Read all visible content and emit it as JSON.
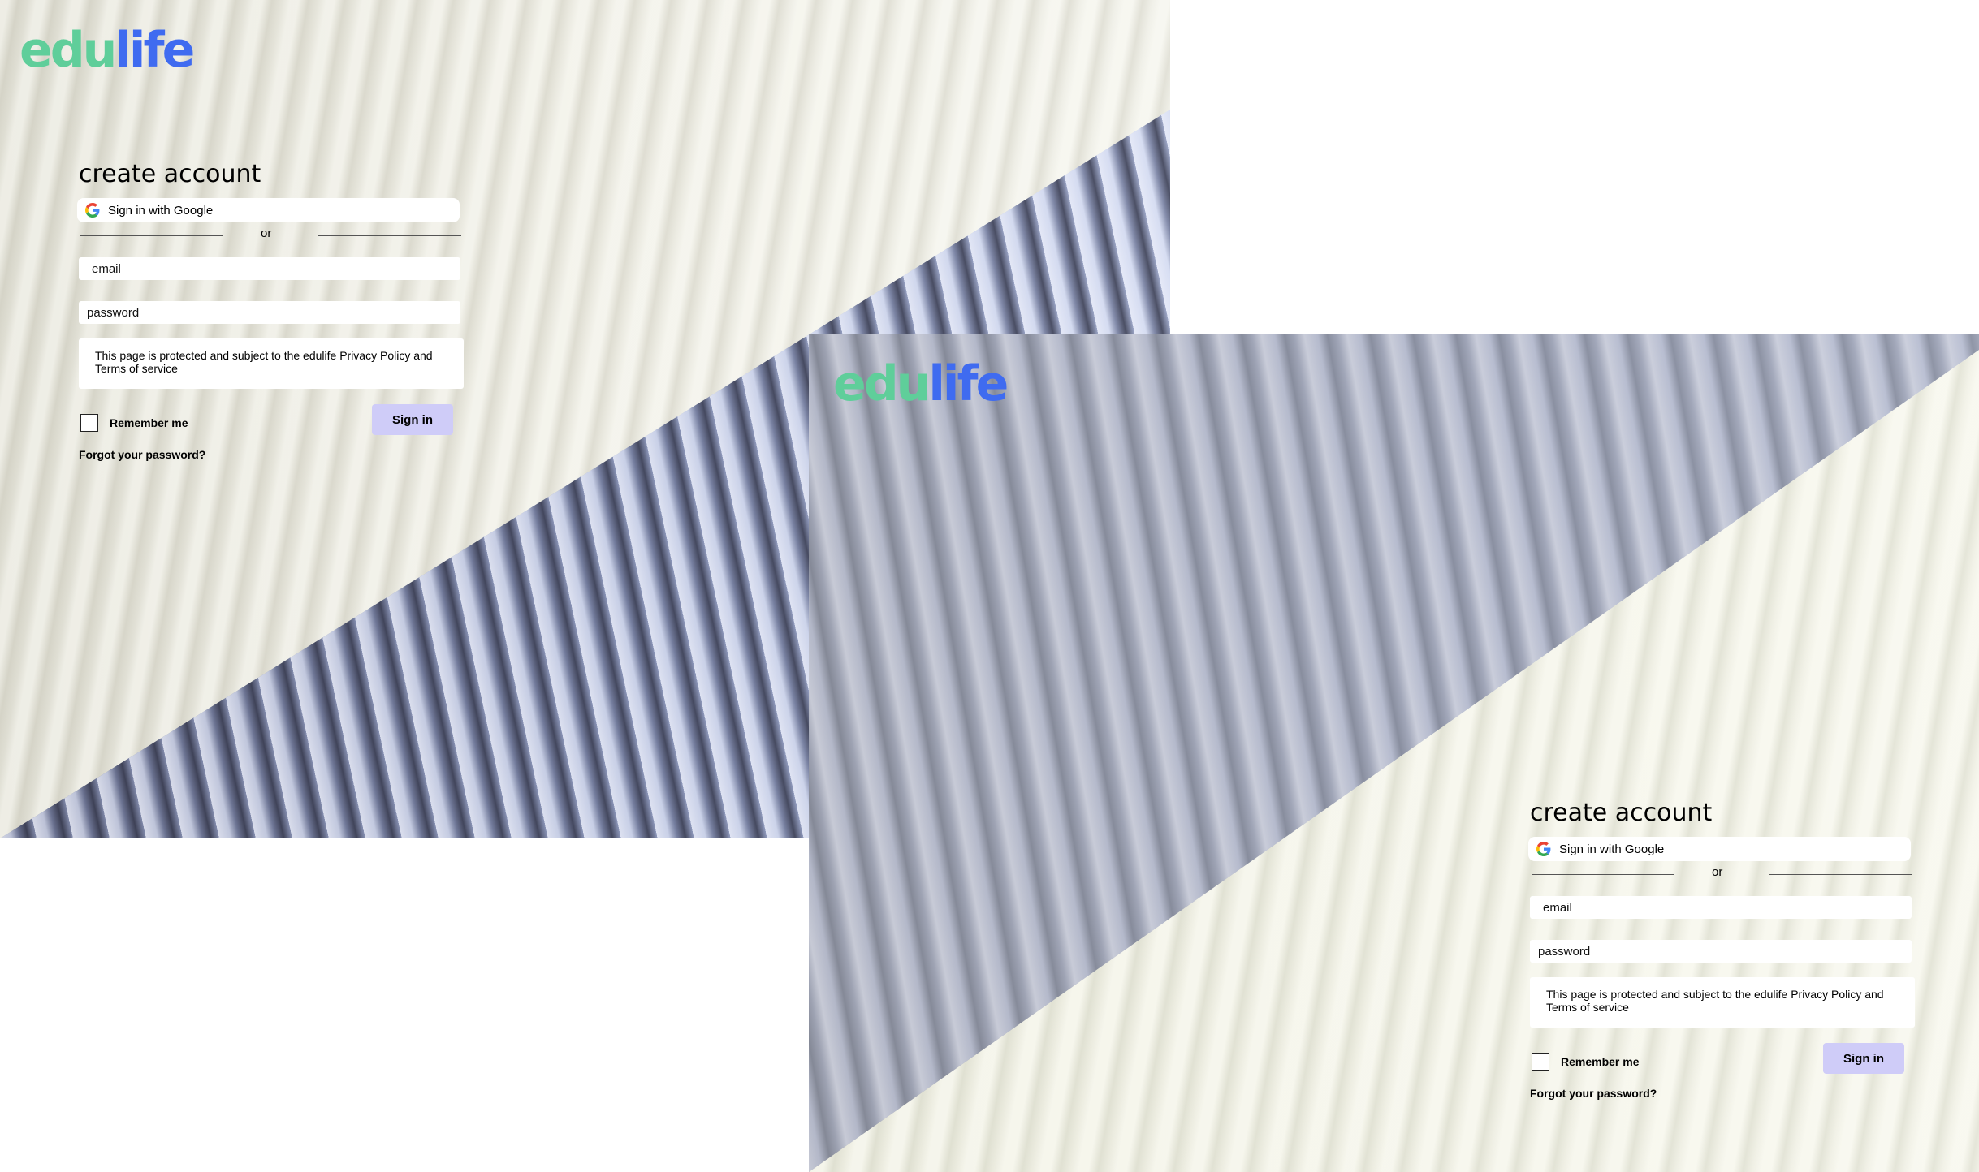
{
  "brand": {
    "edu": "edu",
    "life": "life"
  },
  "form": {
    "title": "create account",
    "google_label": "Sign in with Google",
    "or_label": "or",
    "email_placeholder": "email",
    "password_placeholder": "password",
    "notice": "This page is protected and subject to the edulife Privacy Policy and Terms of service",
    "remember_label": "Remember me",
    "signin_label": "Sign in",
    "forgot_label": "Forgot your password?"
  },
  "colors": {
    "brand_green": "#5fce9a",
    "brand_blue": "#3f6bf0",
    "signin_bg": "#cfccf8"
  },
  "icons": {
    "google": "google-icon"
  }
}
